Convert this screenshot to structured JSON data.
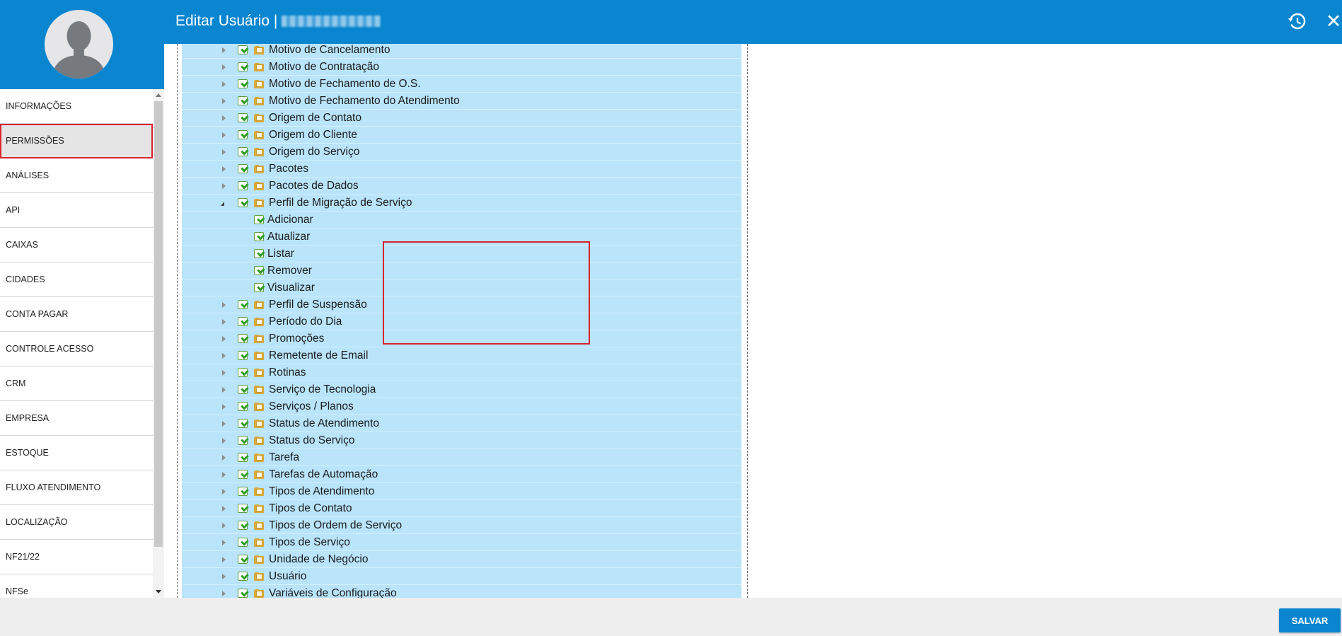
{
  "header": {
    "title": "Editar Usuário |"
  },
  "sidebar": {
    "items": [
      {
        "label": "INFORMAÇÕES"
      },
      {
        "label": "PERMISSÕES"
      },
      {
        "label": "ANÁLISES"
      },
      {
        "label": "API"
      },
      {
        "label": "CAIXAS"
      },
      {
        "label": "CIDADES"
      },
      {
        "label": "CONTA PAGAR"
      },
      {
        "label": "CONTROLE ACESSO"
      },
      {
        "label": "CRM"
      },
      {
        "label": "EMPRESA"
      },
      {
        "label": "ESTOQUE"
      },
      {
        "label": "FLUXO ATENDIMENTO"
      },
      {
        "label": "LOCALIZAÇÃO"
      },
      {
        "label": "NF21/22"
      },
      {
        "label": "NFSe"
      }
    ],
    "active_item": "PERMISSÕES"
  },
  "tree": {
    "rows": [
      {
        "label": "Motivo de Cancelamento",
        "type": "parent",
        "expanded": false,
        "checked": true
      },
      {
        "label": "Motivo de Contratação",
        "type": "parent",
        "expanded": false,
        "checked": true
      },
      {
        "label": "Motivo de Fechamento de O.S.",
        "type": "parent",
        "expanded": false,
        "checked": true
      },
      {
        "label": "Motivo de Fechamento do Atendimento",
        "type": "parent",
        "expanded": false,
        "checked": true
      },
      {
        "label": "Origem de Contato",
        "type": "parent",
        "expanded": false,
        "checked": true
      },
      {
        "label": "Origem do Cliente",
        "type": "parent",
        "expanded": false,
        "checked": true
      },
      {
        "label": "Origem do Serviço",
        "type": "parent",
        "expanded": false,
        "checked": true
      },
      {
        "label": "Pacotes",
        "type": "parent",
        "expanded": false,
        "checked": true
      },
      {
        "label": "Pacotes de Dados",
        "type": "parent",
        "expanded": false,
        "checked": true
      },
      {
        "label": "Perfil de Migração de Serviço",
        "type": "parent",
        "expanded": true,
        "checked": true
      },
      {
        "label": "Adicionar",
        "type": "child",
        "checked": true
      },
      {
        "label": "Atualizar",
        "type": "child",
        "checked": true
      },
      {
        "label": "Listar",
        "type": "child",
        "checked": true
      },
      {
        "label": "Remover",
        "type": "child",
        "checked": true
      },
      {
        "label": "Visualizar",
        "type": "child",
        "checked": true
      },
      {
        "label": "Perfil de Suspensão",
        "type": "parent",
        "expanded": false,
        "checked": true
      },
      {
        "label": "Período do Dia",
        "type": "parent",
        "expanded": false,
        "checked": true
      },
      {
        "label": "Promoções",
        "type": "parent",
        "expanded": false,
        "checked": true
      },
      {
        "label": "Remetente de Email",
        "type": "parent",
        "expanded": false,
        "checked": true
      },
      {
        "label": "Rotinas",
        "type": "parent",
        "expanded": false,
        "checked": true
      },
      {
        "label": "Serviço de Tecnologia",
        "type": "parent",
        "expanded": false,
        "checked": true
      },
      {
        "label": "Serviços / Planos",
        "type": "parent",
        "expanded": false,
        "checked": true
      },
      {
        "label": "Status de Atendimento",
        "type": "parent",
        "expanded": false,
        "checked": true
      },
      {
        "label": "Status do Serviço",
        "type": "parent",
        "expanded": false,
        "checked": true
      },
      {
        "label": "Tarefa",
        "type": "parent",
        "expanded": false,
        "checked": true
      },
      {
        "label": "Tarefas de Automação",
        "type": "parent",
        "expanded": false,
        "checked": true
      },
      {
        "label": "Tipos de Atendimento",
        "type": "parent",
        "expanded": false,
        "checked": true
      },
      {
        "label": "Tipos de Contato",
        "type": "parent",
        "expanded": false,
        "checked": true
      },
      {
        "label": "Tipos de Ordem de Serviço",
        "type": "parent",
        "expanded": false,
        "checked": true
      },
      {
        "label": "Tipos de Serviço",
        "type": "parent",
        "expanded": false,
        "checked": true
      },
      {
        "label": "Unidade de Negócio",
        "type": "parent",
        "expanded": false,
        "checked": true
      },
      {
        "label": "Usuário",
        "type": "parent",
        "expanded": false,
        "checked": true
      },
      {
        "label": "Variáveis de Configuração",
        "type": "parent",
        "expanded": false,
        "checked": true
      }
    ]
  },
  "footer": {
    "save_label": "SALVAR"
  },
  "colors": {
    "primary": "#0a86d0",
    "tree_row": "#b9e4fa",
    "highlight": "#d9232e",
    "check": "#2f9e21",
    "folder": "#d9a93b"
  },
  "icons": {
    "avatar": "user-silhouette-icon",
    "history": "history-icon",
    "close": "close-icon",
    "expander": "triangle-expander-icon",
    "checkbox": "checkbox-checked-icon",
    "folder": "folder-icon"
  }
}
